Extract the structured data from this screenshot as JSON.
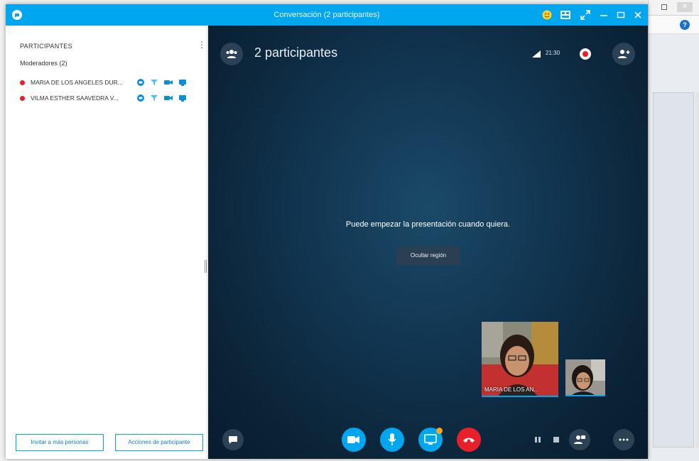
{
  "window": {
    "title": "Conversación (2 participantes)"
  },
  "left_pane": {
    "header": "PARTICIPANTES",
    "menu_glyph": "⋮",
    "moderators_label": "Moderadores (2)",
    "participants": [
      {
        "name": "MARIA DE LOS ANGELES DUR...",
        "status": "busy"
      },
      {
        "name": "VILMA ESTHER SAAVEDRA V...",
        "status": "busy"
      }
    ],
    "invite_button": "Invitar a más personas",
    "actions_button": "Acciones de participante"
  },
  "meeting": {
    "participants_count": "2 participantes",
    "call_time": "21:30",
    "present_message": "Puede empezar la presentación cuando quiera.",
    "hide_region_button": "Ocultar región",
    "main_video_label": "MARIA DE LOS AN..."
  },
  "colors": {
    "accent": "#00a7ef",
    "hangup": "#e8202a",
    "busy_status": "#e8202a",
    "stage_dark": "#0b2438"
  },
  "icons": {
    "titlebar": [
      "skype-icon",
      "emoji-icon",
      "layout-icon",
      "fullscreen-icon",
      "minimize-icon",
      "maximize-icon",
      "close-icon"
    ],
    "call_bar": [
      "im-icon",
      "video-icon",
      "microphone-icon",
      "share-screen-icon",
      "hangup-icon",
      "pause-icon",
      "stop-icon",
      "participant-video-icon",
      "more-icon"
    ]
  }
}
